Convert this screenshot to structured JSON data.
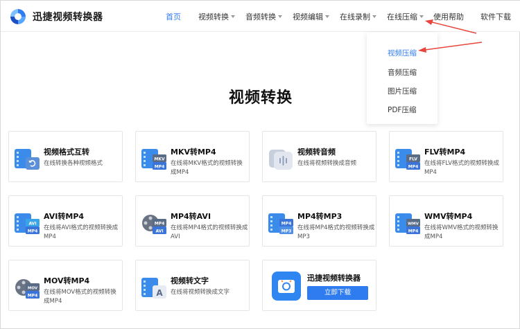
{
  "brand": {
    "name": "迅捷视频转换器"
  },
  "nav": [
    {
      "label": "首页"
    },
    {
      "label": "视频转换"
    },
    {
      "label": "音频转换"
    },
    {
      "label": "视频编辑"
    },
    {
      "label": "在线录制"
    },
    {
      "label": "在线压缩"
    },
    {
      "label": "使用帮助"
    },
    {
      "label": "软件下载"
    }
  ],
  "dropdown": [
    {
      "label": "视频压缩"
    },
    {
      "label": "音频压缩"
    },
    {
      "label": "图片压缩"
    },
    {
      "label": "PDF压缩"
    }
  ],
  "main": {
    "title": "视频转换"
  },
  "cards": [
    {
      "title": "视频格式互转",
      "desc": "在线转换各种视频格式",
      "icon": "video-convert-icon",
      "badge": ""
    },
    {
      "title": "MKV转MP4",
      "desc": "在线将MKV格式的视频转换成MP4",
      "icon": "mkv-to-mp4-icon",
      "badge": "MKV"
    },
    {
      "title": "视频转音频",
      "desc": "在线将视频转换成音频",
      "icon": "video-to-audio-icon",
      "badge": ""
    },
    {
      "title": "FLV转MP4",
      "desc": "在线将FLV格式的视频转换成MP4",
      "icon": "flv-to-mp4-icon",
      "badge": "FLV"
    },
    {
      "title": "AVI转MP4",
      "desc": "在线将AVI格式的视频转换成MP4",
      "icon": "avi-to-mp4-icon",
      "badge": "AVI"
    },
    {
      "title": "MP4转AVI",
      "desc": "在线将MP4格式的视频转换成AVI",
      "icon": "mp4-to-avi-icon",
      "badge": "MP4"
    },
    {
      "title": "MP4转MP3",
      "desc": "在线将MP4格式的视频转换成MP3",
      "icon": "mp4-to-mp3-icon",
      "badge": "MP4"
    },
    {
      "title": "WMV转MP4",
      "desc": "在线将WMV格式的视频转换成MP4",
      "icon": "wmv-to-mp4-icon",
      "badge": "WMV"
    },
    {
      "title": "MOV转MP4",
      "desc": "在线将MOV格式的视频转换成MP4",
      "icon": "mov-to-mp4-icon",
      "badge": "MOV"
    },
    {
      "title": "视频转文字",
      "desc": "在线将视频转换成文字",
      "icon": "video-to-text-icon",
      "badge": ""
    }
  ],
  "promo": {
    "title": "迅捷视频转换器",
    "button": "立即下载"
  },
  "colors": {
    "accent": "#2f7bf0",
    "arrow": "#e8453c"
  }
}
